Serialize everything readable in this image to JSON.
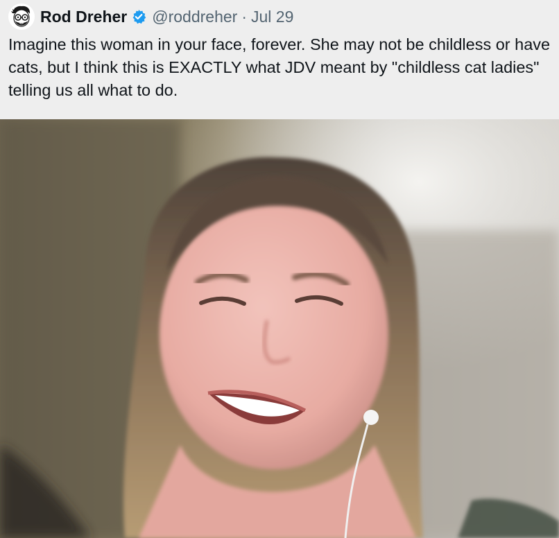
{
  "tweet": {
    "author": {
      "display_name": "Rod Dreher",
      "handle": "@roddreher",
      "separator": "·",
      "date": "Jul 29",
      "verified": true,
      "avatar_icon": "cartoon-portrait-avatar"
    },
    "text": "Imagine this woman in your face, forever. She may not be childless or have cats, but I think this is EXACTLY what JDV meant by \"childless cat ladies\" telling us all what to do.",
    "colors": {
      "verified_badge": "#1d9bf0",
      "name_text": "#0f1419",
      "secondary_text": "#536471",
      "background": "#eeeeee"
    },
    "media": {
      "kind": "video-still",
      "icon": "photo-of-smiling-woman"
    }
  }
}
